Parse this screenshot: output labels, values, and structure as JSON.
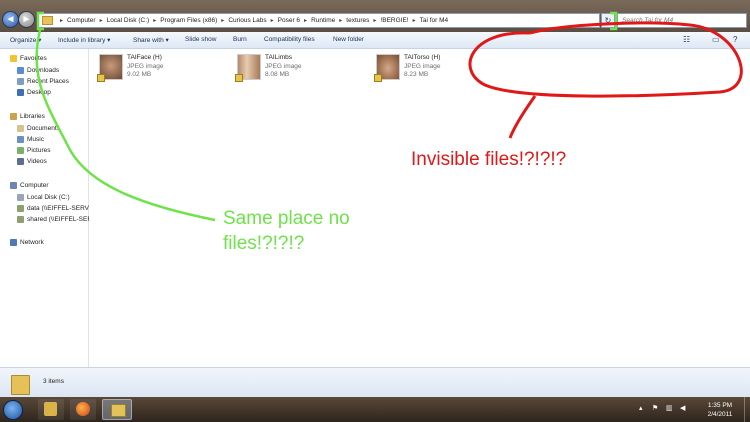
{
  "breadcrumbs": [
    "Computer",
    "Local Disk (C:)",
    "Program Files (x86)",
    "Curious Labs",
    "Poser 6",
    "Runtime",
    "textures",
    "!BERGIE!",
    "Tai for M4"
  ],
  "search": {
    "placeholder": "Search Tai for M4"
  },
  "toolbar": {
    "organize": "Organize ▾",
    "include": "Include in library ▾",
    "share": "Share with ▾",
    "slideshow": "Slide show",
    "burn": "Burn",
    "compat": "Compatibility files",
    "newfolder": "New folder"
  },
  "sidebar": {
    "favorites": "Favorites",
    "downloads": "Downloads",
    "recent": "Recent Places",
    "desktop": "Desktop",
    "libraries": "Libraries",
    "documents": "Documents",
    "music": "Music",
    "pictures": "Pictures",
    "videos": "Videos",
    "computer": "Computer",
    "localdisk": "Local Disk (C:)",
    "data": "data (\\\\EIFFEL-SERVER)",
    "shared": "shared (\\\\EIFFEL-SERVER)",
    "network": "Network"
  },
  "files": [
    {
      "name": "TAIFace (H)",
      "type": "JPEG image",
      "size": "9.02 MB"
    },
    {
      "name": "TAILimbs",
      "type": "JPEG image",
      "size": "8.08 MB"
    },
    {
      "name": "TAITorso (H)",
      "type": "JPEG image",
      "size": "8.23 MB"
    }
  ],
  "details": {
    "count": "3 items"
  },
  "clock": {
    "time": "1:35 PM",
    "date": "2/4/2011"
  },
  "annotations": {
    "green": [
      "Same place no",
      "files!?!?!?"
    ],
    "red": "Invisible files!?!?!?"
  },
  "colors": {
    "annotation_green": "#6fe24a",
    "annotation_red": "#e01818"
  }
}
